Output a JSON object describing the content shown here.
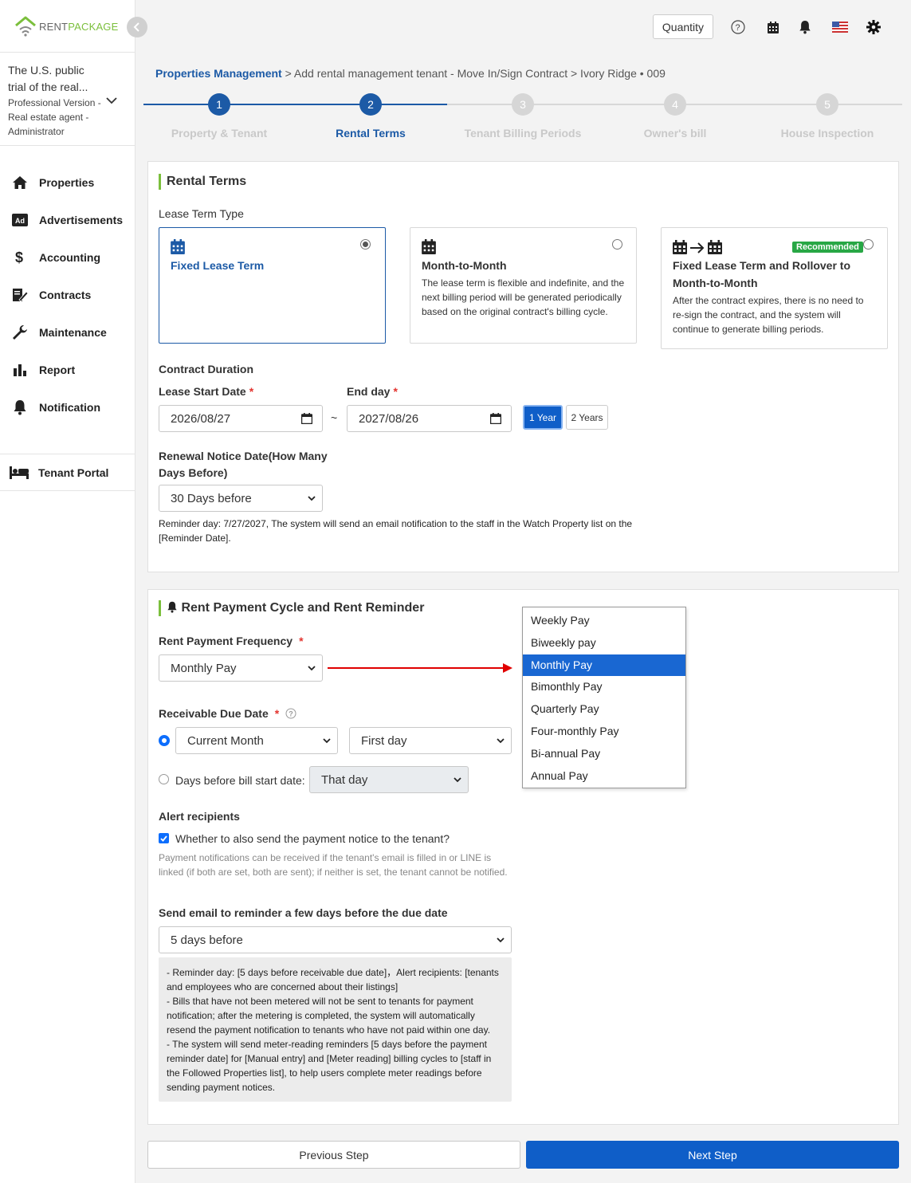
{
  "colors": {
    "brand_green": "#7bbf3c",
    "primary_blue": "#0f5ec8",
    "active_step": "#1c5aa6",
    "inactive_step": "#d0d0d0",
    "recommended": "#28a745",
    "arrow_red": "#e00000"
  },
  "logo": {
    "rent": "RENT",
    "package": "PACKAGE"
  },
  "account": {
    "title": "The U.S. public trial of the real...",
    "subtitle": "Professional Version - Real estate agent - Administrator"
  },
  "sidebar": {
    "items": [
      {
        "label": "Properties",
        "icon": "home-icon"
      },
      {
        "label": "Advertisements",
        "icon": "ad-icon"
      },
      {
        "label": "Accounting",
        "icon": "dollar-icon"
      },
      {
        "label": "Contracts",
        "icon": "contract-icon"
      },
      {
        "label": "Maintenance",
        "icon": "wrench-icon"
      },
      {
        "label": "Report",
        "icon": "bar-chart-icon"
      },
      {
        "label": "Notification",
        "icon": "bell-icon"
      }
    ],
    "tenant_portal": "Tenant Portal"
  },
  "topbar": {
    "quantity": "Quantity"
  },
  "breadcrumb": {
    "root": "Properties Management",
    "rest": " > Add rental management tenant - Move In/Sign Contract > Ivory Ridge • 009"
  },
  "stepper": {
    "steps": [
      {
        "num": "1",
        "label": "Property & Tenant"
      },
      {
        "num": "2",
        "label": "Rental Terms"
      },
      {
        "num": "3",
        "label": "Tenant Billing Periods"
      },
      {
        "num": "4",
        "label": "Owner's bill"
      },
      {
        "num": "5",
        "label": "House Inspection"
      }
    ],
    "current": 2
  },
  "rental_terms": {
    "title": "Rental Terms",
    "lease_term_type": "Lease Term Type",
    "options": [
      {
        "title": "Fixed Lease Term",
        "desc": "",
        "selected": true
      },
      {
        "title": "Month-to-Month",
        "desc": "The lease term is flexible and indefinite, and the next billing period will be generated periodically based on the original contract's billing cycle.",
        "selected": false
      },
      {
        "title": "Fixed Lease Term and Rollover to Month-to-Month",
        "desc": "After the contract expires, there is no need to re-sign the contract, and the system will continue to generate billing periods.",
        "selected": false,
        "badge": "Recommended"
      }
    ],
    "contract_duration": "Contract Duration",
    "start_label": "Lease Start Date",
    "start_value": "2026/08/27",
    "end_label": "End day",
    "end_value": "2027/08/26",
    "tilde": "~",
    "year_1": "1 Year",
    "year_2": "2 Years",
    "renewal_label": "Renewal Notice Date(How Many Days Before)",
    "renewal_value": "30 Days before",
    "reminder_note": "Reminder day: 7/27/2027, The system will send an email notification to the staff in the Watch Property list on the [Reminder Date]."
  },
  "payment": {
    "title": "Rent Payment Cycle and Rent Reminder",
    "freq_label": "Rent Payment Frequency",
    "freq_value": "Monthly Pay",
    "freq_options": [
      "Weekly Pay",
      "Biweekly pay",
      "Monthly Pay",
      "Bimonthly Pay",
      "Quarterly Pay",
      "Four-monthly Pay",
      "Bi-annual Pay",
      "Annual Pay"
    ],
    "freq_selected_index": 2,
    "due_label": "Receivable Due Date",
    "due_month": "Current Month",
    "due_day": "First day",
    "days_before_label": "Days before bill start date:",
    "days_before_value": "That day",
    "alert_label": "Alert recipients",
    "send_tenant": "Whether to also send the payment notice to the tenant?",
    "send_tenant_checked": true,
    "tenant_hint": "Payment notifications can be received if the tenant's email is filled in or LINE is linked (if both are set, both are sent); if neither is set, the tenant cannot be notified.",
    "email_label": "Send email to reminder a few days before the due date",
    "email_value": "5 days before",
    "info_lines": [
      "- Reminder day: [5 days before receivable due date]，Alert recipients: [tenants and employees who are concerned about their listings]",
      "- Bills that have not been metered will not be sent to tenants for payment notification; after the metering is completed, the system will automatically resend the payment notification to tenants who have not paid within one day.",
      "- The system will send meter-reading reminders [5 days before the payment reminder date] for [Manual entry] and [Meter reading] billing cycles to [staff in the Followed Properties list], to help users complete meter readings before sending payment notices."
    ]
  },
  "footer": {
    "prev": "Previous Step",
    "next": "Next Step"
  }
}
